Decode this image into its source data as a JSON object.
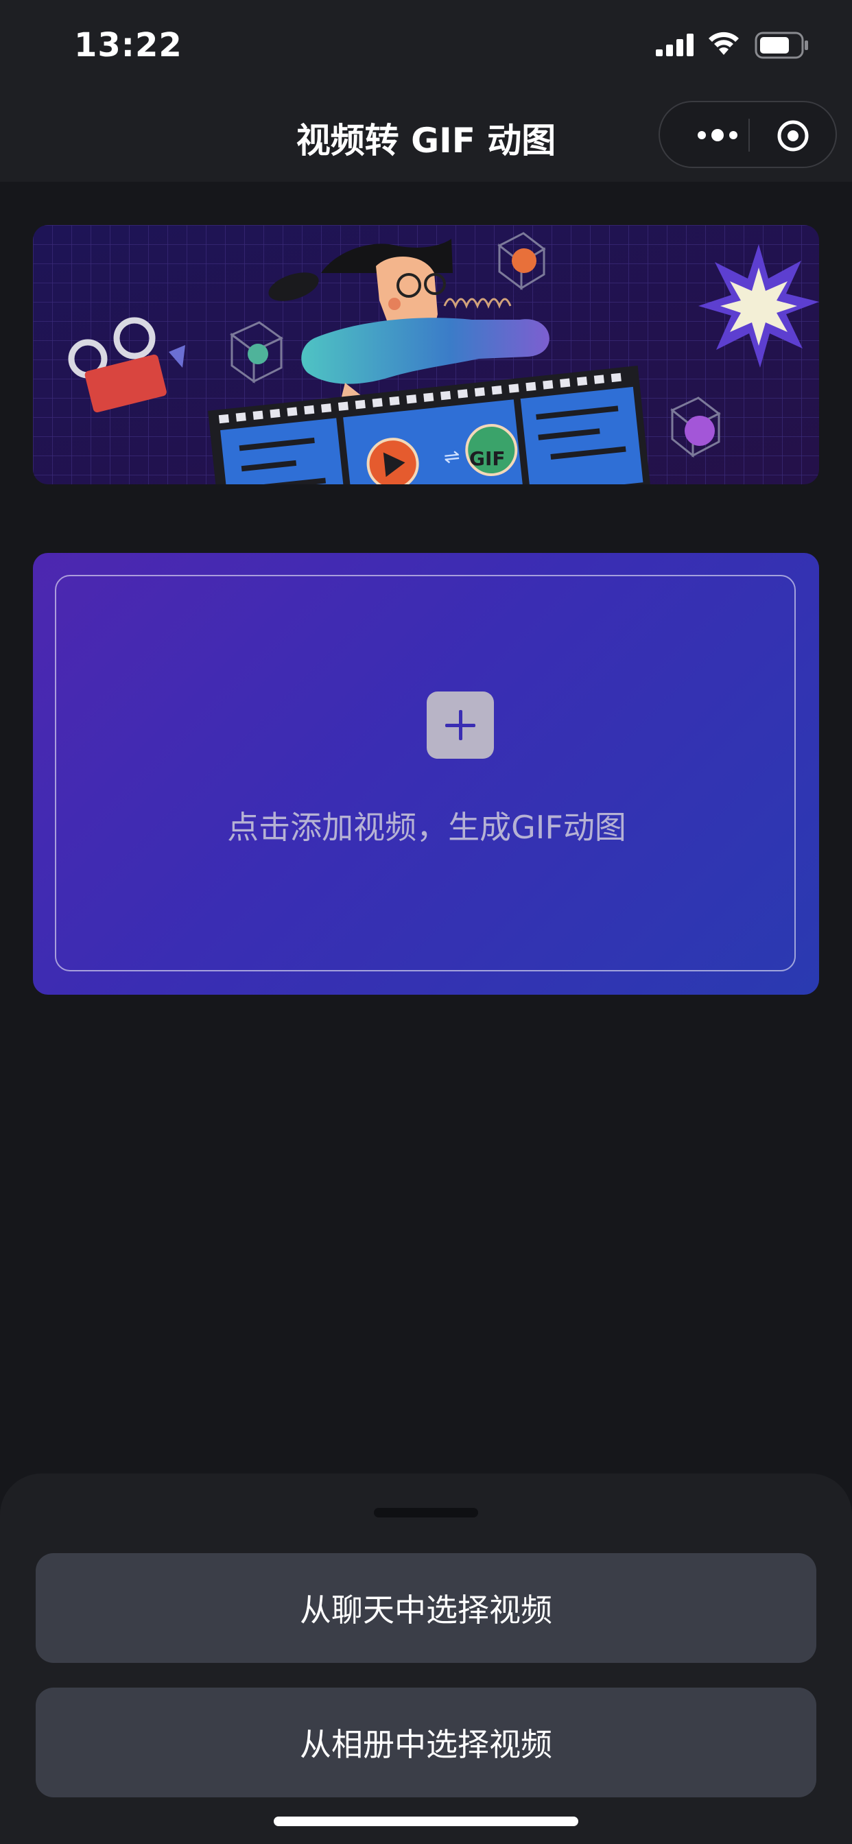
{
  "status_bar": {
    "time": "13:22"
  },
  "nav": {
    "title": "视频转 GIF 动图",
    "more_icon": "more-dots-icon",
    "close_icon": "target-close-icon"
  },
  "banner": {
    "illustration": "video-to-gif-illustration",
    "gif_badge": "GIF"
  },
  "upload": {
    "icon": "plus-icon",
    "text": "点击添加视频，生成GIF动图"
  },
  "sheet": {
    "options": [
      {
        "label": "从聊天中选择视频"
      },
      {
        "label": "从相册中选择视频"
      }
    ]
  },
  "colors": {
    "accent_start": "#4d27b0",
    "accent_end": "#2a3ab1",
    "button_bg": "#3b3e48"
  }
}
